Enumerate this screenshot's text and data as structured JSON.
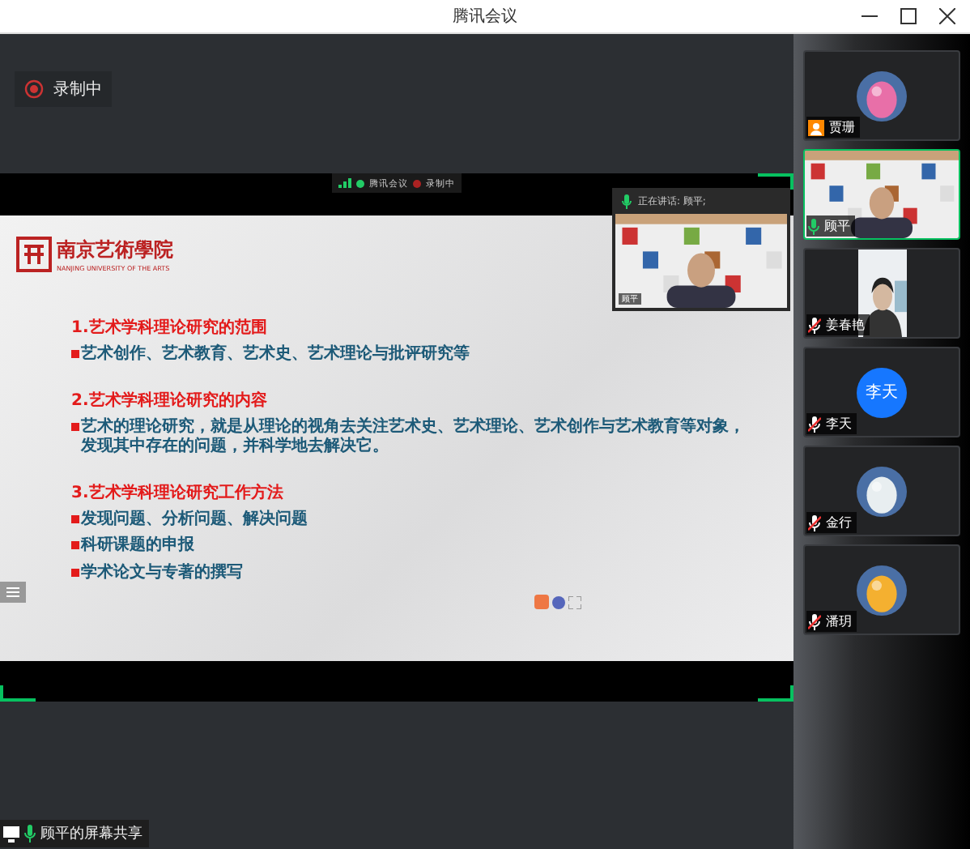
{
  "window": {
    "title": "腾讯会议"
  },
  "recording": {
    "label": "录制中"
  },
  "share_bar": {
    "app": "腾讯会议",
    "recording": "录制中"
  },
  "speaker": {
    "label": "正在讲话: 顾平;",
    "name": "顾平"
  },
  "slide": {
    "logo": "南京艺術學院",
    "logo_sub": "NANJING UNIVERSITY OF THE ARTS",
    "sections": [
      {
        "heading": "1.艺术学科理论研究的范围",
        "bullets": [
          "艺术创作、艺术教育、艺术史、艺术理论与批评研究等"
        ]
      },
      {
        "heading": "2.艺术学科理论研究的内容",
        "bullets": [
          "艺术的理论研究，就是从理论的视角去关注艺术史、艺术理论、艺术创作与艺术教育等对象，发现其中存在的问题，并科学地去解决它。"
        ]
      },
      {
        "heading": "3.艺术学科理论研究工作方法",
        "bullets": [
          "发现问题、分析问题、解决问题",
          "科研课题的申报",
          "学术论文与专著的撰写"
        ]
      }
    ]
  },
  "participants": [
    {
      "name": "贾珊",
      "kind": "avatar",
      "badge": {
        "kind": "user"
      },
      "speaking": false,
      "color": "#e86fa8"
    },
    {
      "name": "顾平",
      "kind": "video",
      "badge": {
        "kind": "mic",
        "muted": false
      },
      "speaking": true
    },
    {
      "name": "姜春艳",
      "kind": "video",
      "badge": {
        "kind": "mic",
        "muted": true
      },
      "speaking": false
    },
    {
      "name": "李天",
      "kind": "initials",
      "initials": "李天",
      "badge": {
        "kind": "mic",
        "muted": true
      },
      "speaking": false,
      "color": "#1677ff"
    },
    {
      "name": "金行",
      "kind": "avatar",
      "badge": {
        "kind": "mic",
        "muted": true
      },
      "speaking": false,
      "color": "#e8eef0"
    },
    {
      "name": "潘玥",
      "kind": "avatar",
      "badge": {
        "kind": "mic",
        "muted": true
      },
      "speaking": false,
      "color": "#f4b030"
    }
  ],
  "share_label": "顾平的屏幕共享"
}
